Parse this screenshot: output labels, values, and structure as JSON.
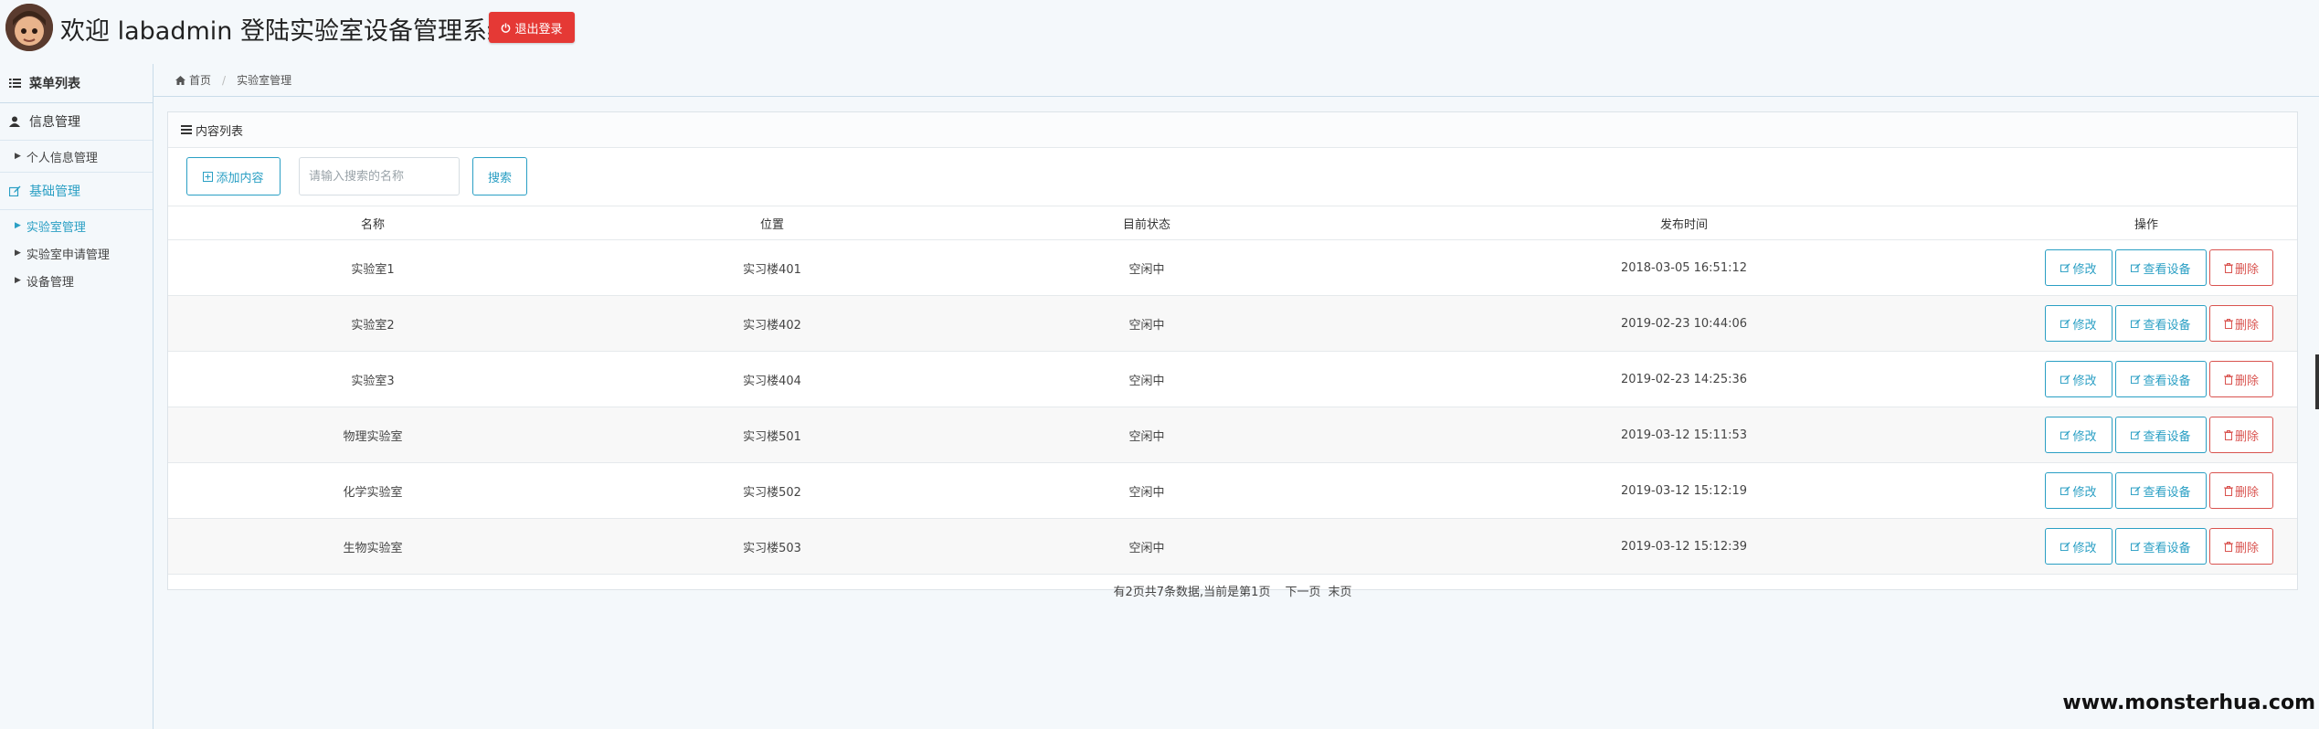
{
  "header": {
    "title": "欢迎 labadmin 登陆实验室设备管理系统",
    "logout_label": "退出登录"
  },
  "sidebar": {
    "title": "菜单列表",
    "groups": [
      {
        "label": "信息管理",
        "items": [
          {
            "label": "个人信息管理"
          }
        ]
      },
      {
        "label": "基础管理",
        "items": [
          {
            "label": "实验室管理"
          },
          {
            "label": "实验室申请管理"
          },
          {
            "label": "设备管理"
          }
        ]
      }
    ]
  },
  "breadcrumb": {
    "home": "首页",
    "current": "实验室管理"
  },
  "panel": {
    "title": "内容列表",
    "add_label": "添加内容",
    "search_placeholder": "请输入搜索的名称",
    "search_label": "搜索"
  },
  "table": {
    "columns": [
      "名称",
      "位置",
      "目前状态",
      "发布时间",
      "操作"
    ],
    "rows": [
      {
        "name": "实验室1",
        "location": "实习楼401",
        "status": "空闲中",
        "time": "2018-03-05 16:51:12"
      },
      {
        "name": "实验室2",
        "location": "实习楼402",
        "status": "空闲中",
        "time": "2019-02-23 10:44:06"
      },
      {
        "name": "实验室3",
        "location": "实习楼404",
        "status": "空闲中",
        "time": "2019-02-23 14:25:36"
      },
      {
        "name": "物理实验室",
        "location": "实习楼501",
        "status": "空闲中",
        "time": "2019-03-12 15:11:53"
      },
      {
        "name": "化学实验室",
        "location": "实习楼502",
        "status": "空闲中",
        "time": "2019-03-12 15:12:19"
      },
      {
        "name": "生物实验室",
        "location": "实习楼503",
        "status": "空闲中",
        "time": "2019-03-12 15:12:39"
      }
    ],
    "actions": {
      "edit": "修改",
      "view": "查看设备",
      "delete": "删除"
    }
  },
  "pager": {
    "summary": "有2页共7条数据,当前是第1页",
    "next": "下一页",
    "last": "末页"
  },
  "watermark": "www.monsterhua.com",
  "colors": {
    "accent": "#2a9fc4",
    "danger": "#d9534f",
    "logout": "#e53935"
  }
}
